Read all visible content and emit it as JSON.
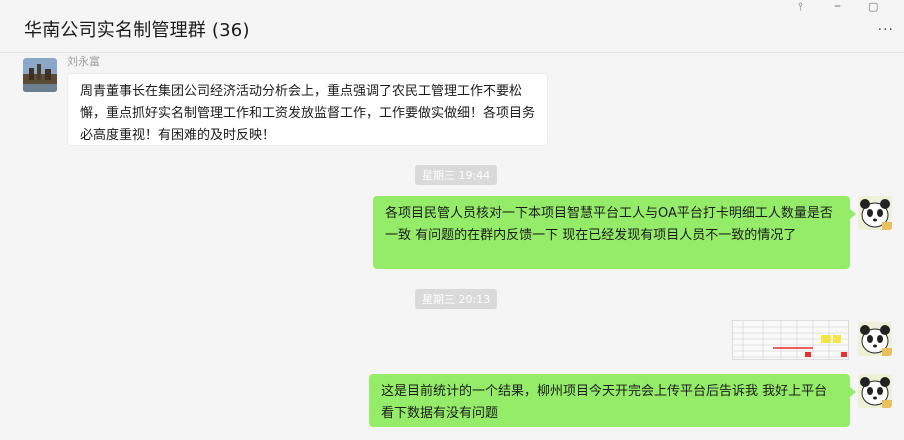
{
  "window": {
    "title": "华南公司实名制管理群 (36)",
    "pin_icon": "pin-icon",
    "minimize_icon": "minimize-icon",
    "maximize_icon": "maximize-icon",
    "more_icon": "more-icon"
  },
  "messages": [
    {
      "sender": "刘永富",
      "text": "周青董事长在集团公司经济活动分析会上，重点强调了农民工管理工作不要松懈，重点抓好实名制管理工作和工资发放监督工作，工作要做实做细！各项目务必高度重视！有困难的及时反映！"
    },
    {
      "timestamp": "星期三 19:44"
    },
    {
      "text": "各项目民管人员核对一下本项目智慧平台工人与OA平台打卡明细工人数量是否一致 有问题的在群内反馈一下 现在已经发现有项目人员不一致的情况了"
    },
    {
      "timestamp": "星期三 20:13"
    },
    {
      "text": "这是目前统计的一个结果，柳州项目今天开完会上传平台后告诉我   我好上平台看下数据有没有问题"
    }
  ],
  "colors": {
    "background": "#f5f5f5",
    "outgoing_bubble": "#95ec69",
    "incoming_bubble": "#ffffff",
    "timestamp_bg": "#dadada"
  }
}
